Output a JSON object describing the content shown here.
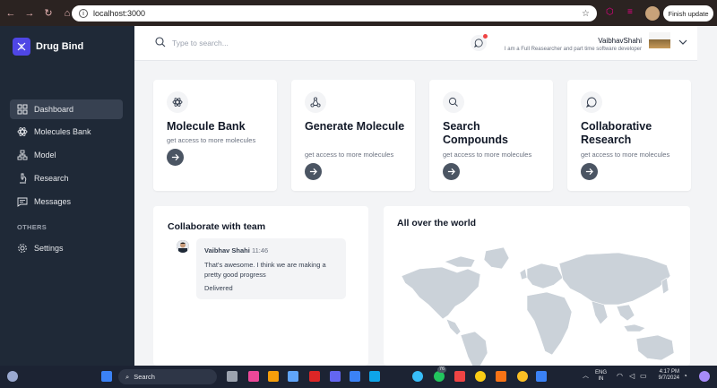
{
  "browser": {
    "url": "localhost:3000",
    "finish_update": "Finish update"
  },
  "sidebar": {
    "app_name": "Drug Bind",
    "items": [
      {
        "label": "Dashboard",
        "icon": "dashboard-icon",
        "active": true
      },
      {
        "label": "Molecules Bank",
        "icon": "atom-icon"
      },
      {
        "label": "Model",
        "icon": "model-icon"
      },
      {
        "label": "Research",
        "icon": "microscope-icon"
      },
      {
        "label": "Messages",
        "icon": "message-icon"
      }
    ],
    "section_label": "OTHERS",
    "settings_label": "Settings"
  },
  "header": {
    "search_placeholder": "Type to search...",
    "user_name": "VaibhavShahi",
    "user_bio": "I am a Full Reasearcher and part time software developer"
  },
  "cards": [
    {
      "title": "Molecule Bank",
      "subtitle": "get access to more molecules",
      "icon": "atom-icon"
    },
    {
      "title": "Generate Molecule",
      "subtitle": "get access to more molecules",
      "icon": "network-icon"
    },
    {
      "title": "Search Compounds",
      "subtitle": "get access to more molecules",
      "icon": "search-icon"
    },
    {
      "title": "Collaborative Research",
      "subtitle": "get access to more molecules",
      "icon": "chat-icon"
    }
  ],
  "collaborate": {
    "title": "Collaborate with team",
    "message": {
      "name": "Vaibhav Shahi",
      "time": "11:46",
      "text": "That's awesome. I think we are making a pretty good progress",
      "status": "Delivered"
    }
  },
  "world": {
    "title": "All over the world"
  },
  "taskbar": {
    "search_label": "Search",
    "language": "ENG",
    "region": "IN",
    "time": "4:17 PM",
    "date": "9/7/2024",
    "badge_count": "76"
  },
  "colors": {
    "sidebar_bg": "#1f2937",
    "accent": "#4f46e5",
    "arrow_button": "#4b5563",
    "map_land": "#cbd2d9"
  }
}
